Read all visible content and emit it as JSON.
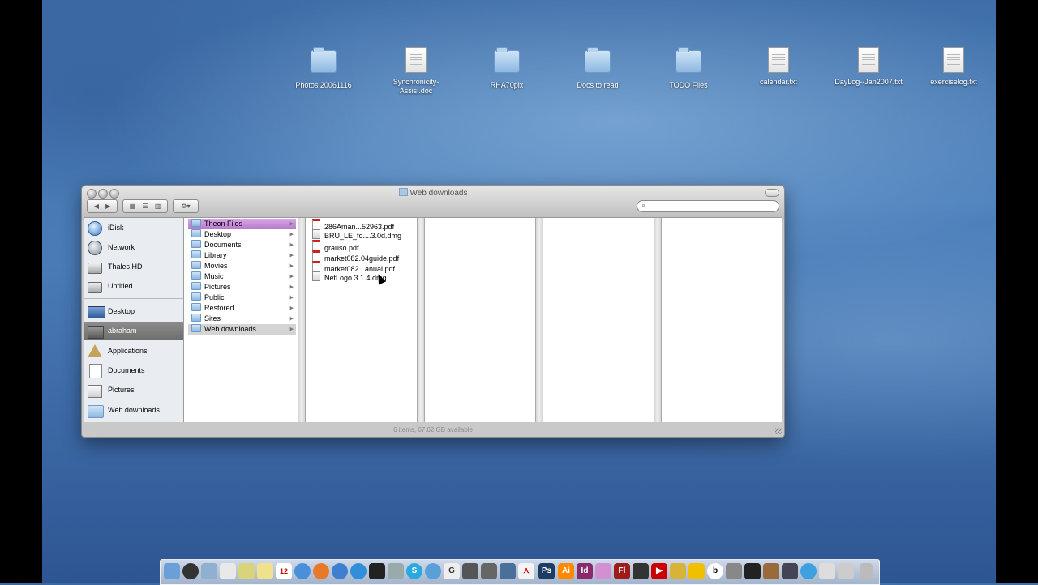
{
  "desktop": {
    "icons": [
      {
        "label": "Photos 20061116",
        "type": "folder"
      },
      {
        "label": "Synchronicity-Assisi.doc",
        "type": "doc"
      },
      {
        "label": "RHA70pix",
        "type": "folder"
      },
      {
        "label": "Docs to read",
        "type": "folder"
      },
      {
        "label": "TODO Files",
        "type": "folder"
      },
      {
        "label": "calendar.txt",
        "type": "doc"
      },
      {
        "label": "DayLog--Jan2007.txt",
        "type": "doc"
      },
      {
        "label": "exerciselog.txt",
        "type": "doc"
      }
    ]
  },
  "window": {
    "title": "Web downloads",
    "status": "6 items, 67.62 GB available",
    "search_placeholder": "",
    "toolbar": {
      "back_icon": "back-arrow-icon",
      "forward_icon": "forward-arrow-icon",
      "view_icon": "view-mode-icon",
      "action_icon": "gear-icon"
    }
  },
  "sidebar": {
    "devices": [
      {
        "label": "iDisk",
        "icon": "idisk-icon"
      },
      {
        "label": "Network",
        "icon": "network-icon"
      },
      {
        "label": "Thales HD",
        "icon": "hard-drive-icon"
      },
      {
        "label": "Untitled",
        "icon": "hard-drive-icon"
      }
    ],
    "places": [
      {
        "label": "Desktop",
        "icon": "desktop-icon",
        "selected": false
      },
      {
        "label": "abraham",
        "icon": "home-icon",
        "selected": true
      },
      {
        "label": "Applications",
        "icon": "applications-icon",
        "selected": false
      },
      {
        "label": "Documents",
        "icon": "documents-icon",
        "selected": false
      },
      {
        "label": "Pictures",
        "icon": "pictures-icon",
        "selected": false
      },
      {
        "label": "Web downloads",
        "icon": "folder-icon",
        "selected": false
      }
    ]
  },
  "columns": {
    "home_folders": [
      {
        "label": "Theon Files",
        "state": "labeled-purple"
      },
      {
        "label": "Desktop",
        "state": ""
      },
      {
        "label": "Documents",
        "state": ""
      },
      {
        "label": "Library",
        "state": ""
      },
      {
        "label": "Movies",
        "state": ""
      },
      {
        "label": "Music",
        "state": ""
      },
      {
        "label": "Pictures",
        "state": ""
      },
      {
        "label": "Public",
        "state": ""
      },
      {
        "label": "Restored",
        "state": ""
      },
      {
        "label": "Sites",
        "state": ""
      },
      {
        "label": "Web downloads",
        "state": "selected"
      }
    ],
    "files": [
      {
        "label": "286Aman...52963.pdf",
        "kind": "pdf"
      },
      {
        "label": "BRU_LE_fo....3.0d.dmg",
        "kind": "dmg"
      },
      {
        "label": "grauso.pdf",
        "kind": "pdf"
      },
      {
        "label": "market082.04guide.pdf",
        "kind": "pdf"
      },
      {
        "label": "market082...anual.pdf",
        "kind": "pdf"
      },
      {
        "label": "NetLogo 3.1.4.dmg",
        "kind": "dmg"
      }
    ]
  },
  "dock": {
    "apps": [
      "Finder",
      "Dashboard",
      "Mail",
      "Preview",
      "Notes",
      "Stickies",
      "iCal",
      "Safari",
      "Firefox",
      "Network",
      "Earth",
      "Terminal",
      "Skype",
      "Chat",
      "Google",
      "Dictionary",
      "Pen",
      "Browser",
      "Acrobat",
      "Ps",
      "Ai",
      "Id",
      "Photos",
      "Fl",
      "Game",
      "Player",
      "Audio",
      "Books",
      "Movie",
      "Keys",
      "Clean",
      "Video",
      "Web",
      "Utility",
      "Printer",
      "Trash"
    ]
  },
  "colors": {
    "accent_purple": "#c78ad9",
    "selection_gray": "#7a7a7a"
  }
}
